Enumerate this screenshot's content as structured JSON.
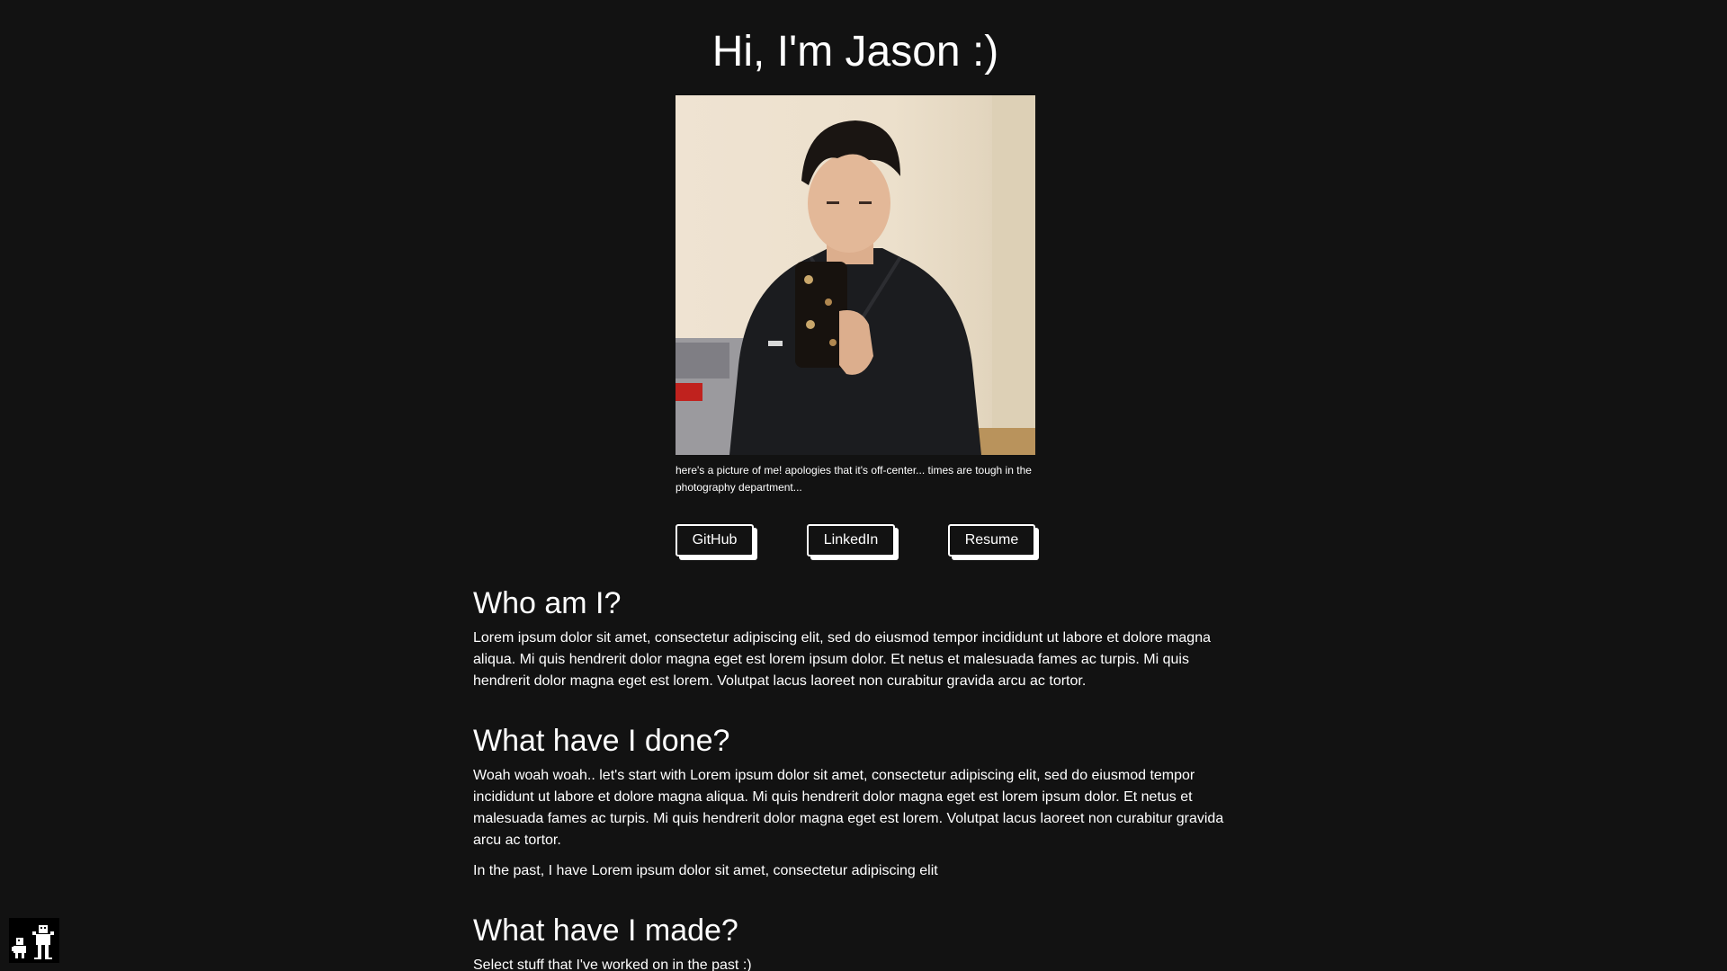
{
  "header": {
    "title": "Hi, I'm Jason :)"
  },
  "profile": {
    "caption": "here's a picture of me! apologies that it's off-center... times are tough in the photography department..."
  },
  "links": {
    "github_label": "GitHub",
    "linkedin_label": "LinkedIn",
    "resume_label": "Resume"
  },
  "sections": [
    {
      "heading": "Who am I?",
      "paragraphs": [
        "Lorem ipsum dolor sit amet, consectetur adipiscing elit, sed do eiusmod tempor incididunt ut labore et dolore magna aliqua. Mi quis hendrerit dolor magna eget est lorem ipsum dolor. Et netus et malesuada fames ac turpis. Mi quis hendrerit dolor magna eget est lorem. Volutpat lacus laoreet non curabitur gravida arcu ac tortor."
      ]
    },
    {
      "heading": "What have I done?",
      "paragraphs": [
        "Woah woah woah.. let's start with Lorem ipsum dolor sit amet, consectetur adipiscing elit, sed do eiusmod tempor incididunt ut labore et dolore magna aliqua. Mi quis hendrerit dolor magna eget est lorem ipsum dolor. Et netus et malesuada fames ac turpis. Mi quis hendrerit dolor magna eget est lorem. Volutpat lacus laoreet non curabitur gravida arcu ac tortor.",
        "In the past, I have Lorem ipsum dolor sit amet, consectetur adipiscing elit"
      ]
    },
    {
      "heading": "What have I made?",
      "paragraphs": [
        "Select stuff that I've worked on in the past :)"
      ]
    }
  ],
  "colors": {
    "background": "#121212",
    "text": "#ffffff",
    "button_border": "#ffffff"
  },
  "icons": {
    "corner_badge": "pixel-art-character-icon"
  }
}
